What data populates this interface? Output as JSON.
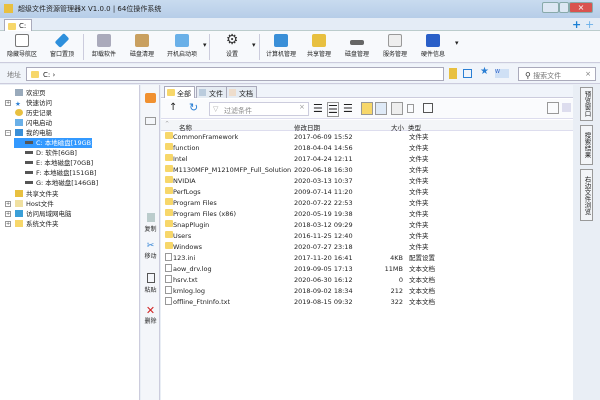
{
  "window": {
    "title": "超级文件资源管理器X V1.0.0 | 64位操作系统",
    "tab": "C:"
  },
  "toolbar": [
    "隐藏导航区",
    "窗口置顶",
    "卸载软件",
    "磁盘清理",
    "开机启动项",
    "设置",
    "计算机管理",
    "共享管理",
    "磁盘管理",
    "服务管理",
    "硬件信息"
  ],
  "address": {
    "label": "地址",
    "path": "C:  ›",
    "search_placeholder": "搜索文件"
  },
  "tree": [
    {
      "label": "欢迎页"
    },
    {
      "label": "快速访问"
    },
    {
      "label": "历史记录"
    },
    {
      "label": "闪电启动"
    },
    {
      "label": "我的电脑"
    },
    {
      "label": "C: 本地磁盘[19GB]"
    },
    {
      "label": "D: 软件[6GB]"
    },
    {
      "label": "E: 本地磁盘[70GB]"
    },
    {
      "label": "F: 本地磁盘[151GB]"
    },
    {
      "label": "G: 本地磁盘[146GB]"
    },
    {
      "label": "共享文件夹"
    },
    {
      "label": "Host文件"
    },
    {
      "label": "访问局域网电脑"
    },
    {
      "label": "系统文件夹"
    }
  ],
  "side_actions": [
    "复制",
    "移动",
    "粘贴",
    "删除"
  ],
  "file_tabs": [
    "全部",
    "文件",
    "文档"
  ],
  "filter_placeholder": "过滤条件",
  "columns": {
    "name": "名称",
    "date": "修改日期",
    "size": "大小",
    "type": "类型"
  },
  "files": [
    {
      "name": "CommonFramework",
      "date": "2017-06-09 15:52",
      "size": "",
      "type": "文件夹",
      "kind": "folder"
    },
    {
      "name": "function",
      "date": "2018-04-04 14:56",
      "size": "",
      "type": "文件夹",
      "kind": "folder"
    },
    {
      "name": "Intel",
      "date": "2017-04-24 12:11",
      "size": "",
      "type": "文件夹",
      "kind": "folder"
    },
    {
      "name": "M1130MFP_M1210MFP_Full_Solution",
      "date": "2020-06-18 16:30",
      "size": "",
      "type": "文件夹",
      "kind": "folder"
    },
    {
      "name": "NVIDIA",
      "date": "2020-03-13 10:37",
      "size": "",
      "type": "文件夹",
      "kind": "folder"
    },
    {
      "name": "PerfLogs",
      "date": "2009-07-14 11:20",
      "size": "",
      "type": "文件夹",
      "kind": "folder"
    },
    {
      "name": "Program Files",
      "date": "2020-07-22 22:53",
      "size": "",
      "type": "文件夹",
      "kind": "folder"
    },
    {
      "name": "Program Files (x86)",
      "date": "2020-05-19 19:38",
      "size": "",
      "type": "文件夹",
      "kind": "folder"
    },
    {
      "name": "SnapPlugin",
      "date": "2018-03-12 09:29",
      "size": "",
      "type": "文件夹",
      "kind": "folder"
    },
    {
      "name": "Users",
      "date": "2016-11-25 12:40",
      "size": "",
      "type": "文件夹",
      "kind": "folder"
    },
    {
      "name": "Windows",
      "date": "2020-07-27 23:18",
      "size": "",
      "type": "文件夹",
      "kind": "folder"
    },
    {
      "name": "123.ini",
      "date": "2017-11-20 16:41",
      "size": "4KB",
      "type": "配置设置",
      "kind": "file"
    },
    {
      "name": "aow_drv.log",
      "date": "2019-09-05 17:13",
      "size": "11MB",
      "type": "文本文档",
      "kind": "file"
    },
    {
      "name": "hsrv.txt",
      "date": "2020-06-30 16:12",
      "size": "0",
      "type": "文本文档",
      "kind": "file"
    },
    {
      "name": "kmlog.log",
      "date": "2018-09-02 18:34",
      "size": "212",
      "type": "文本文档",
      "kind": "file"
    },
    {
      "name": "offline_FtnInfo.txt",
      "date": "2019-08-15 09:32",
      "size": "322",
      "type": "文本文档",
      "kind": "file"
    }
  ],
  "right_tabs": [
    "预览窗口",
    "搜索结果",
    "右边文件浏览"
  ],
  "colors": {
    "selection": "#3399ff",
    "folder": "#f7d76a"
  }
}
